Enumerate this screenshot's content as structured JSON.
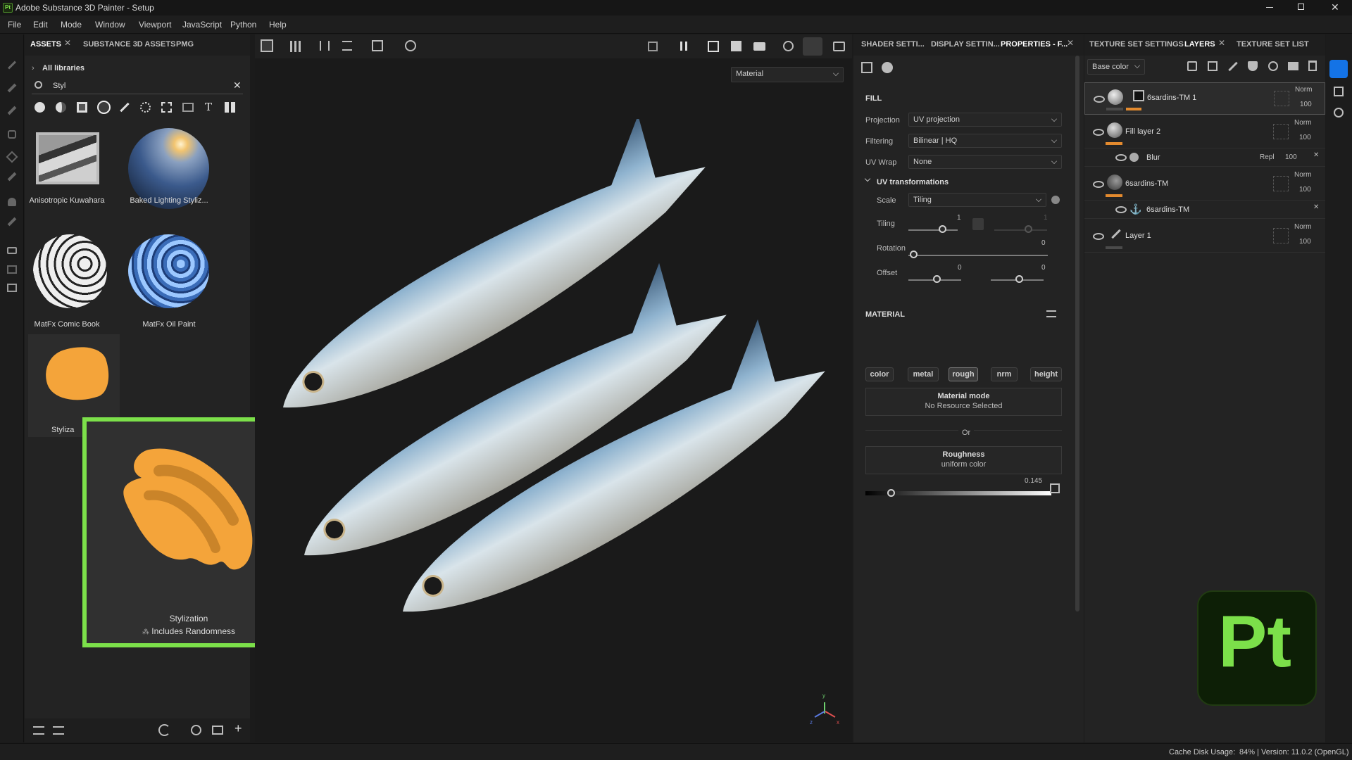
{
  "window": {
    "title": "Adobe Substance 3D Painter - Setup",
    "app_icon": "Pt"
  },
  "menu": [
    "File",
    "Edit",
    "Mode",
    "Window",
    "Viewport",
    "JavaScript",
    "Python",
    "Help"
  ],
  "assets_panel": {
    "tabs": [
      "ASSETS",
      "SUBSTANCE 3D ASSETS",
      "PMG"
    ],
    "breadcrumb": "All libraries",
    "search_value": "Styl",
    "items": [
      {
        "label": "Anisotropic Kuwahara"
      },
      {
        "label": "Baked Lighting Styliz..."
      },
      {
        "label": "MatFx Comic Book"
      },
      {
        "label": "MatFx Oil Paint"
      },
      {
        "label": "Styliza"
      }
    ],
    "preview": {
      "title": "Stylization",
      "subtitle": "Includes Randomness"
    }
  },
  "viewport": {
    "mode_select": "Material",
    "axis_labels": {
      "y": "y",
      "x": "x",
      "z": "z"
    }
  },
  "properties_panel": {
    "tabs": [
      "SHADER SETTI...",
      "DISPLAY SETTIN...",
      "PROPERTIES - F..."
    ],
    "fill_section": "FILL",
    "projection": {
      "label": "Projection",
      "value": "UV projection"
    },
    "filtering": {
      "label": "Filtering",
      "value": "Bilinear | HQ"
    },
    "uvwrap": {
      "label": "UV Wrap",
      "value": "None"
    },
    "uv_transform": "UV transformations",
    "scale": {
      "label": "Scale",
      "value": "Tiling"
    },
    "tiling": {
      "label": "Tiling",
      "value1": "1",
      "value2": "1"
    },
    "rotation": {
      "label": "Rotation",
      "value": "0"
    },
    "offset": {
      "label": "Offset",
      "value1": "0",
      "value2": "0"
    },
    "material_section": "MATERIAL",
    "channels": [
      "color",
      "metal",
      "rough",
      "nrm",
      "height"
    ],
    "selected_channel": "rough",
    "material_mode": {
      "title": "Material mode",
      "subtitle": "No Resource Selected"
    },
    "or_text": "Or",
    "roughness": {
      "title": "Roughness",
      "subtitle": "uniform color",
      "value": "0.145"
    }
  },
  "layers_panel": {
    "tabs": [
      "TEXTURE SET SETTINGS",
      "LAYERS",
      "TEXTURE SET LIST"
    ],
    "channel_select": "Base color",
    "layers": [
      {
        "name": "6sardins-TM 1",
        "blend": "Norm",
        "opacity": "100"
      },
      {
        "name": "Fill layer 2",
        "blend": "Norm",
        "opacity": "100"
      },
      {
        "name": "Blur",
        "blend": "Repl",
        "opacity": "100"
      },
      {
        "name": "6sardins-TM",
        "blend": "Norm",
        "opacity": "100"
      },
      {
        "name": "6sardins-TM",
        "blend": "",
        "opacity": ""
      },
      {
        "name": "Layer 1",
        "blend": "Norm",
        "opacity": "100"
      }
    ]
  },
  "status": {
    "cache_label": "Cache Disk Usage:",
    "info": "84% | Version: 11.0.2 (OpenGL)"
  },
  "badge": {
    "text": "Pt",
    "color": "#7ce04a"
  },
  "colors": {
    "accent_green": "#7ce04a",
    "layer_orange": "#e38a2e",
    "brush_orange": "#f4a43a"
  }
}
